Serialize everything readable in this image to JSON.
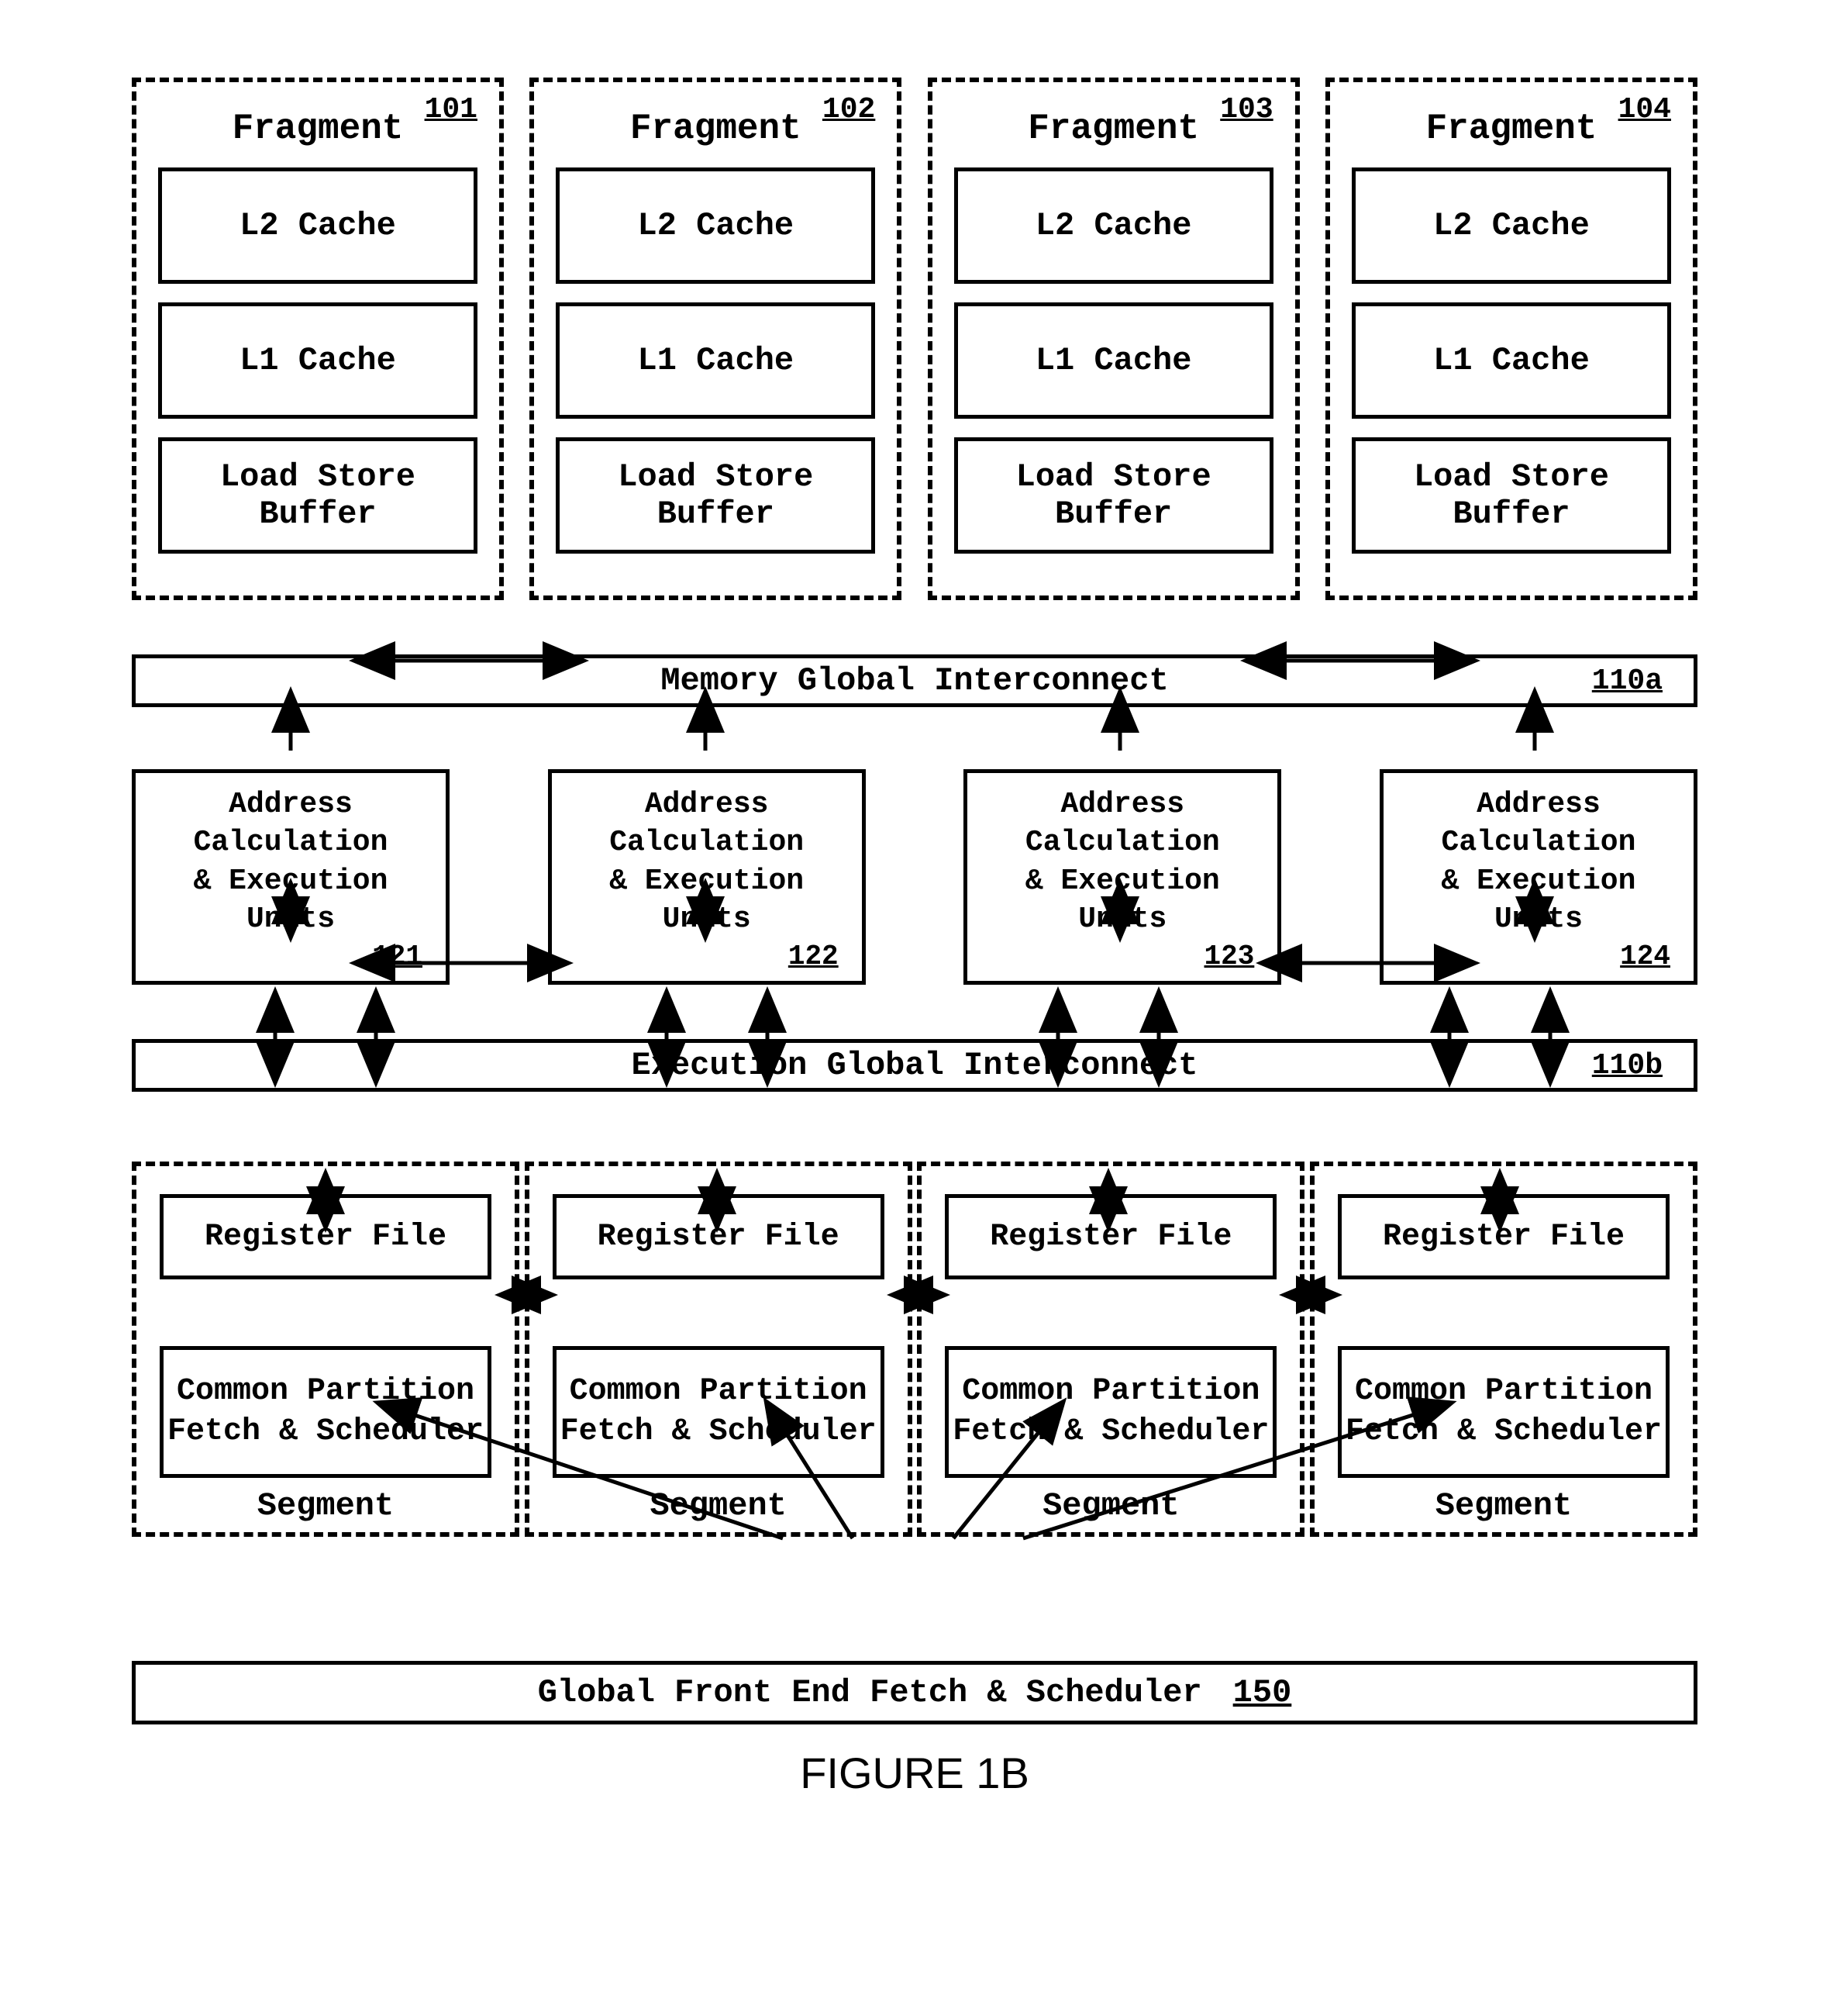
{
  "fragments": [
    {
      "id": "101",
      "title": "Fragment",
      "l2": "L2 Cache",
      "l1": "L1 Cache",
      "lsb": "Load Store Buffer"
    },
    {
      "id": "102",
      "title": "Fragment",
      "l2": "L2 Cache",
      "l1": "L1 Cache",
      "lsb": "Load Store Buffer"
    },
    {
      "id": "103",
      "title": "Fragment",
      "l2": "L2 Cache",
      "l1": "L1 Cache",
      "lsb": "Load Store Buffer"
    },
    {
      "id": "104",
      "title": "Fragment",
      "l2": "L2 Cache",
      "l1": "L1 Cache",
      "lsb": "Load Store Buffer"
    }
  ],
  "mem_interconnect": {
    "label": "Memory Global Interconnect",
    "id": "110a"
  },
  "exec_units": [
    {
      "line1": "Address Calculation",
      "line2": "& Execution Units",
      "id": "121"
    },
    {
      "line1": "Address Calculation",
      "line2": "& Execution Units",
      "id": "122"
    },
    {
      "line1": "Address Calculation",
      "line2": "& Execution Units",
      "id": "123"
    },
    {
      "line1": "Address Calculation",
      "line2": "& Execution Units",
      "id": "124"
    }
  ],
  "exec_interconnect": {
    "label": "Execution Global Interconnect",
    "id": "110b"
  },
  "segments": [
    {
      "regfile": "Register File",
      "cp1": "Common Partition",
      "cp2": "Fetch & Scheduler",
      "label": "Segment"
    },
    {
      "regfile": "Register File",
      "cp1": "Common Partition",
      "cp2": "Fetch & Scheduler",
      "label": "Segment"
    },
    {
      "regfile": "Register File",
      "cp1": "Common Partition",
      "cp2": "Fetch & Scheduler",
      "label": "Segment"
    },
    {
      "regfile": "Register File",
      "cp1": "Common Partition",
      "cp2": "Fetch & Scheduler",
      "label": "Segment"
    }
  ],
  "global_front": {
    "label": "Global Front End Fetch & Scheduler",
    "id": "150"
  },
  "figure": "FIGURE 1B"
}
